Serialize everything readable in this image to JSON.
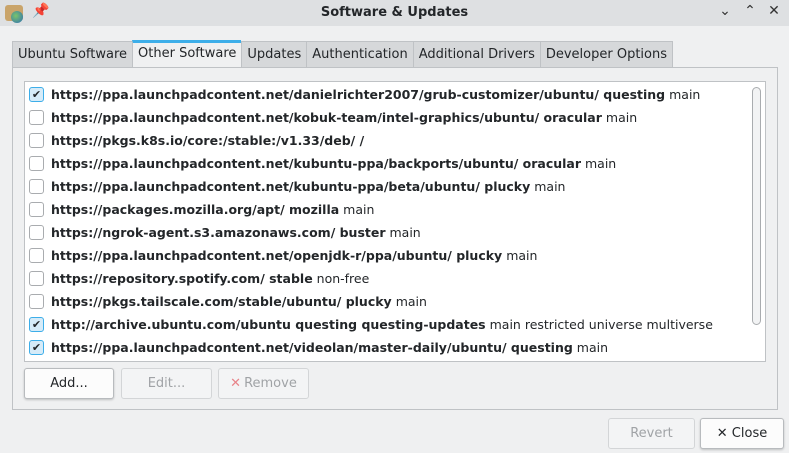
{
  "window": {
    "title": "Software & Updates"
  },
  "tabs": [
    "Ubuntu Software",
    "Other Software",
    "Updates",
    "Authentication",
    "Additional Drivers",
    "Developer Options"
  ],
  "sources": [
    {
      "checked": true,
      "uri": "https://ppa.launchpadcontent.net/danielrichter2007/grub-customizer/ubuntu/ questing",
      "components": "main"
    },
    {
      "checked": false,
      "uri": "https://ppa.launchpadcontent.net/kobuk-team/intel-graphics/ubuntu/ oracular",
      "components": "main"
    },
    {
      "checked": false,
      "uri": "https://pkgs.k8s.io/core:/stable:/v1.33/deb/ /",
      "components": ""
    },
    {
      "checked": false,
      "uri": "https://ppa.launchpadcontent.net/kubuntu-ppa/backports/ubuntu/ oracular",
      "components": "main"
    },
    {
      "checked": false,
      "uri": "https://ppa.launchpadcontent.net/kubuntu-ppa/beta/ubuntu/ plucky",
      "components": "main"
    },
    {
      "checked": false,
      "uri": "https://packages.mozilla.org/apt/ mozilla",
      "components": "main"
    },
    {
      "checked": false,
      "uri": "https://ngrok-agent.s3.amazonaws.com/ buster",
      "components": "main"
    },
    {
      "checked": false,
      "uri": "https://ppa.launchpadcontent.net/openjdk-r/ppa/ubuntu/ plucky",
      "components": "main"
    },
    {
      "checked": false,
      "uri": "https://repository.spotify.com/ stable",
      "components": "non-free"
    },
    {
      "checked": false,
      "uri": "https://pkgs.tailscale.com/stable/ubuntu/ plucky",
      "components": "main"
    },
    {
      "checked": true,
      "uri": "http://archive.ubuntu.com/ubuntu questing questing-updates",
      "components": "main restricted universe multiverse"
    },
    {
      "checked": true,
      "uri": "https://ppa.launchpadcontent.net/videolan/master-daily/ubuntu/ questing",
      "components": "main"
    }
  ],
  "buttons": {
    "add": "Add...",
    "edit": "Edit...",
    "remove": "Remove",
    "revert": "Revert",
    "close": "Close"
  },
  "colors": {
    "accent": "#3daee9"
  }
}
